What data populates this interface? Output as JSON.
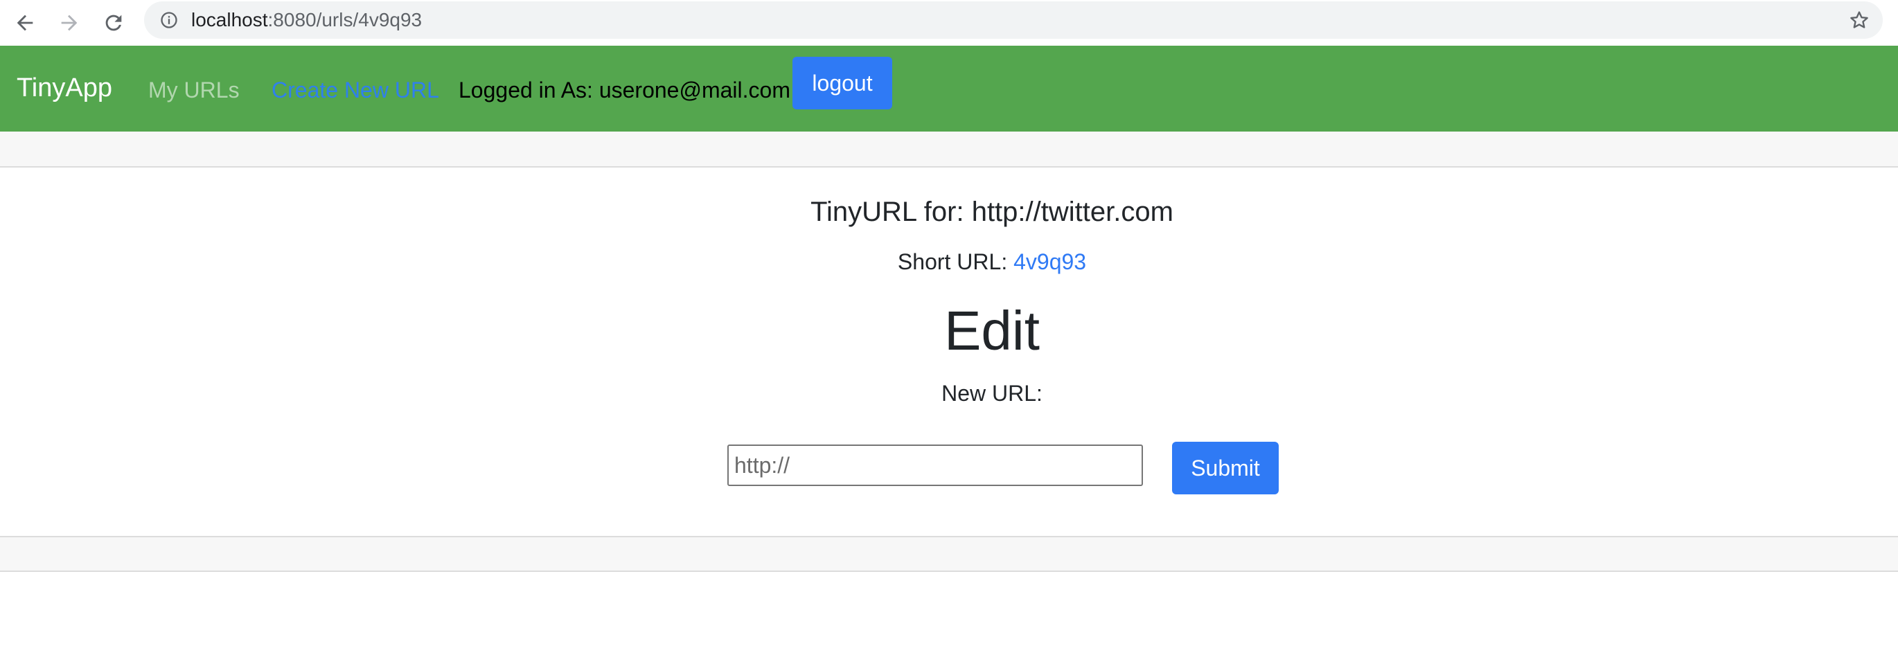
{
  "browser": {
    "url_host": "localhost",
    "url_rest": ":8080/urls/4v9q93",
    "icons": {
      "back": "arrow-left-icon",
      "forward": "arrow-right-icon",
      "reload": "reload-icon",
      "info": "info-icon",
      "bookmark": "star-icon"
    }
  },
  "navbar": {
    "brand": "TinyApp",
    "my_urls": "My URLs",
    "create_new_url": "Create New URL",
    "logged_in_text": "Logged in As: userone@mail.com",
    "logout_label": "logout",
    "colors": {
      "background": "#54a64e",
      "link_active": "#2f80ed",
      "button": "#2f7af5"
    }
  },
  "main": {
    "tinyurl_title": "TinyURL for: http://twitter.com",
    "short_url_label": "Short URL: ",
    "short_url_value": "4v9q93",
    "edit_heading": "Edit",
    "new_url_label": "New URL:",
    "new_url_placeholder": "http://",
    "new_url_value": "",
    "submit_label": "Submit"
  }
}
